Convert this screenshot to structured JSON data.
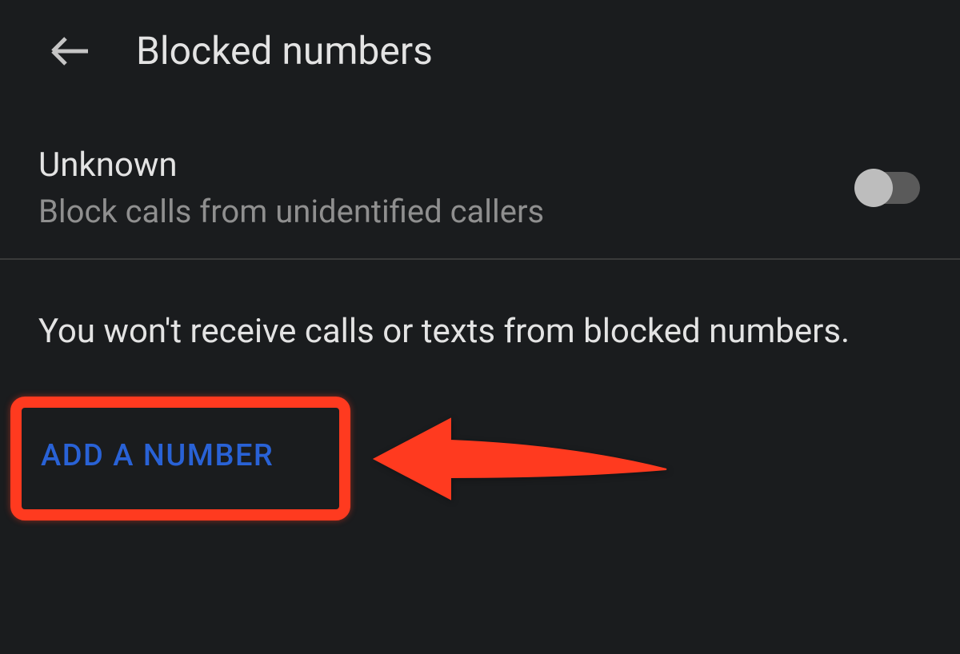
{
  "header": {
    "title": "Blocked numbers"
  },
  "settings": {
    "unknown": {
      "title": "Unknown",
      "subtitle": "Block calls from unidentified callers",
      "enabled": false
    }
  },
  "info": {
    "description": "You won't receive calls or texts from blocked numbers."
  },
  "actions": {
    "add_number": "ADD A NUMBER"
  },
  "colors": {
    "background": "#1a1c1e",
    "text_primary": "#e3e3e3",
    "text_secondary": "#8f8f8f",
    "accent": "#2962d6",
    "annotation": "#ff3a1f"
  }
}
